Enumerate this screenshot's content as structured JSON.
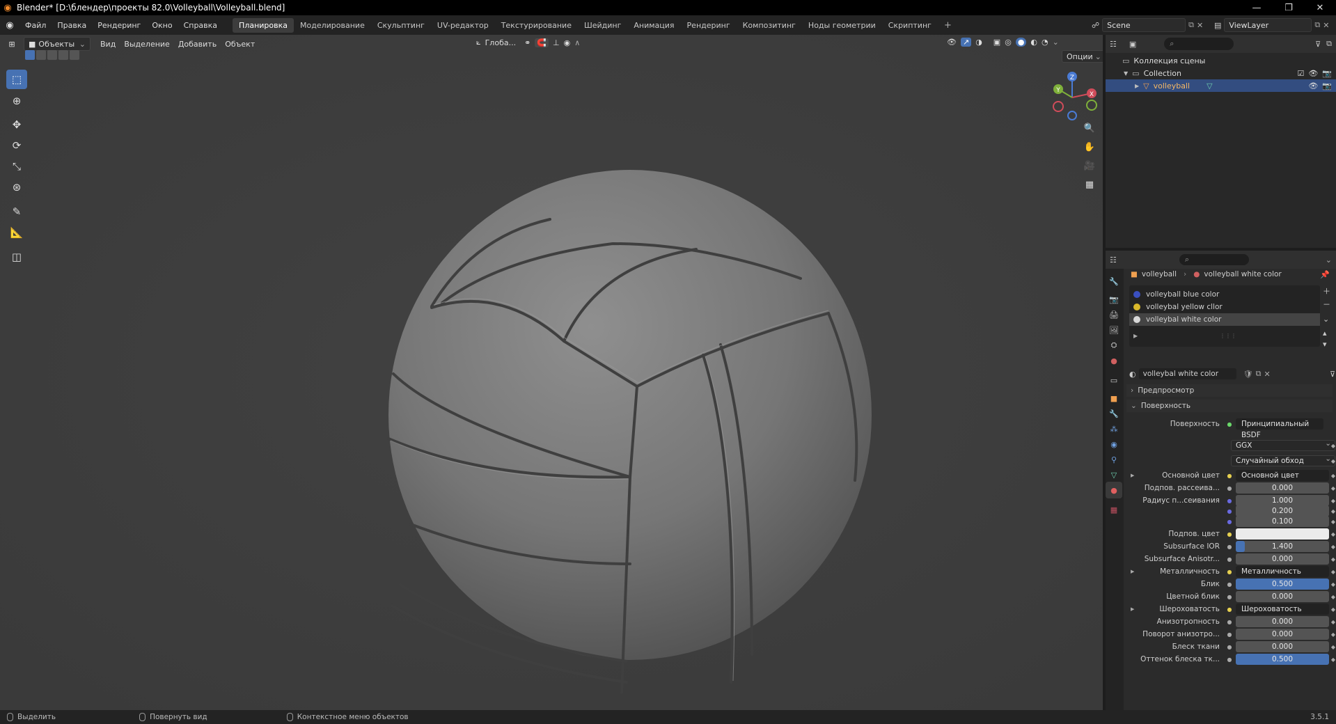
{
  "window": {
    "title": "Blender* [D:\\блендер\\проекты 82.0\\Volleyball\\Volleyball.blend]",
    "controls": [
      "—",
      "❐",
      "✕"
    ]
  },
  "topbar": {
    "menus": [
      "Файл",
      "Правка",
      "Рендеринг",
      "Окно",
      "Справка"
    ],
    "workspaces": [
      "Планировка",
      "Моделирование",
      "Скульптинг",
      "UV-редактор",
      "Текстурирование",
      "Шейдинг",
      "Анимация",
      "Рендеринг",
      "Композитинг",
      "Ноды геометрии",
      "Скриптинг"
    ],
    "active_workspace": "Планировка",
    "scene": "Scene",
    "view_layer": "ViewLayer"
  },
  "viewport": {
    "mode": "Объекты",
    "menus": [
      "Вид",
      "Выделение",
      "Добавить",
      "Объект"
    ],
    "transform_orientation": "Глоба...",
    "options_label": "Опции",
    "gizmo": {
      "x": "X",
      "y": "Y",
      "z": "Z"
    },
    "tools": [
      "select-box",
      "cursor",
      "move",
      "rotate",
      "scale",
      "transform",
      "annotate",
      "measure",
      "add-cube"
    ]
  },
  "outliner": {
    "root": "Коллекция сцены",
    "collection": "Collection",
    "object": "volleyball"
  },
  "properties": {
    "breadcrumb_object": "volleyball",
    "breadcrumb_material": "volleyball white color",
    "slots": [
      {
        "name": "volleyball blue color",
        "color": "#3a4fbf"
      },
      {
        "name": "volleybal yellow cllor",
        "color": "#d9b82a"
      },
      {
        "name": "volleybal white color",
        "color": "#d8d8d8"
      }
    ],
    "active_slot": 2,
    "material_name": "volleybal white color",
    "sections": {
      "preview": "Предпросмотр",
      "surface": "Поверхность"
    },
    "surface_shader_label": "Поверхность",
    "surface_shader": "Принципиальный BSDF",
    "distribution": "GGX",
    "subsurface_method": "Случайный обход",
    "rows": [
      {
        "label": "Основной цвет",
        "type": "link",
        "value": "Основной цвет",
        "expand": true
      },
      {
        "label": "Подпов. рассеива...",
        "type": "num",
        "value": "0.000",
        "fill": 0
      },
      {
        "label": "Радиус п...сеивания",
        "type": "num",
        "value": "1.000",
        "fill": 0
      },
      {
        "label": "",
        "type": "num",
        "value": "0.200",
        "fill": 0
      },
      {
        "label": "",
        "type": "num",
        "value": "0.100",
        "fill": 0
      },
      {
        "label": "Подпов. цвет",
        "type": "color",
        "value": "#ebebeb"
      },
      {
        "label": "Subsurface IOR",
        "type": "num",
        "value": "1.400",
        "fill": 0.1
      },
      {
        "label": "Subsurface Anisotr...",
        "type": "num",
        "value": "0.000",
        "fill": 0
      },
      {
        "label": "Металличность",
        "type": "link",
        "value": "Металличность",
        "expand": true
      },
      {
        "label": "Блик",
        "type": "num",
        "value": "0.500",
        "fill": 1.0
      },
      {
        "label": "Цветной блик",
        "type": "num",
        "value": "0.000",
        "fill": 0
      },
      {
        "label": "Шероховатость",
        "type": "link",
        "value": "Шероховатость",
        "expand": true
      },
      {
        "label": "Анизотропность",
        "type": "num",
        "value": "0.000",
        "fill": 0
      },
      {
        "label": "Поворот анизотро...",
        "type": "num",
        "value": "0.000",
        "fill": 0
      },
      {
        "label": "Блеск ткани",
        "type": "num",
        "value": "0.000",
        "fill": 0
      },
      {
        "label": "Оттенок блеска тк...",
        "type": "num",
        "value": "0.500",
        "fill": 1.0
      }
    ]
  },
  "statusbar": {
    "items": [
      "Выделить",
      "Повернуть вид",
      "Контекстное меню объектов"
    ],
    "version": "3.5.1"
  }
}
